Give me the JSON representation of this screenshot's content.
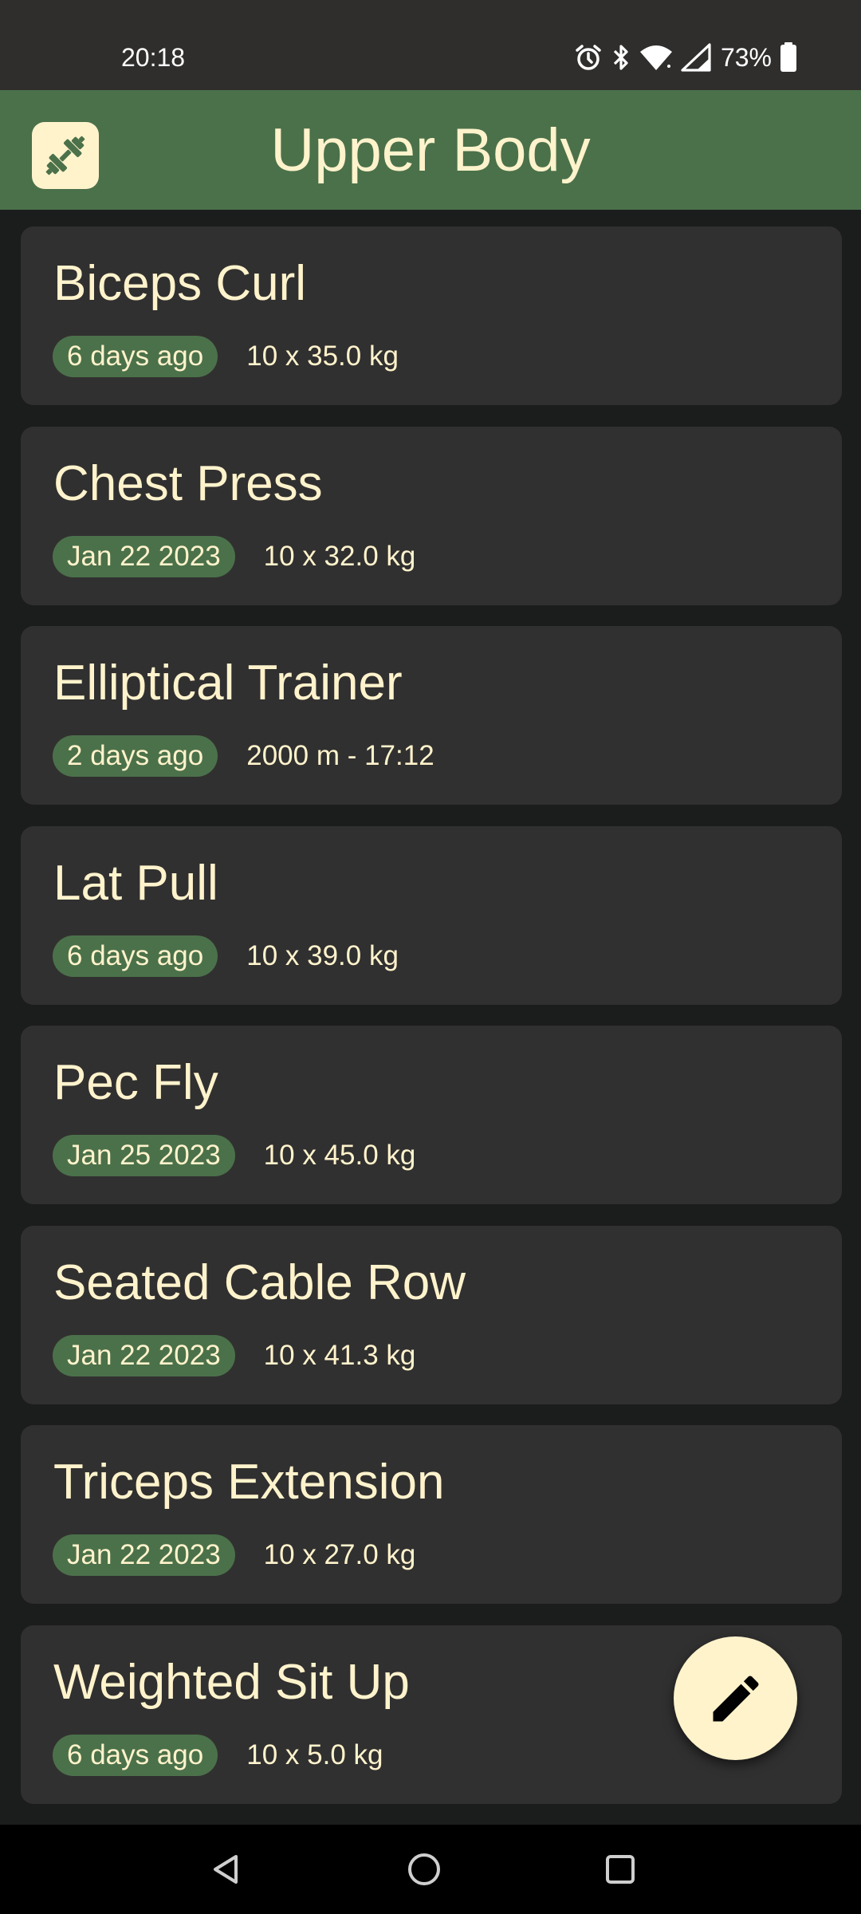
{
  "status_bar": {
    "time": "20:18",
    "battery": "73%",
    "icons": [
      "alarm-icon",
      "bluetooth-icon",
      "wifi-icon",
      "cellular-signal-icon",
      "battery-icon"
    ]
  },
  "app_bar": {
    "title": "Upper Body",
    "logo_icon": "dumbbell-icon"
  },
  "exercises": [
    {
      "name": "Biceps Curl",
      "last_done": "6 days ago",
      "detail": "10 x 35.0 kg"
    },
    {
      "name": "Chest Press",
      "last_done": "Jan 22 2023",
      "detail": "10 x 32.0 kg"
    },
    {
      "name": "Elliptical Trainer",
      "last_done": "2 days ago",
      "detail": "2000 m - 17:12"
    },
    {
      "name": "Lat Pull",
      "last_done": "6 days ago",
      "detail": "10 x 39.0 kg"
    },
    {
      "name": "Pec Fly",
      "last_done": "Jan 25 2023",
      "detail": "10 x 45.0 kg"
    },
    {
      "name": "Seated Cable Row",
      "last_done": "Jan 22 2023",
      "detail": "10 x 41.3 kg"
    },
    {
      "name": "Triceps Extension",
      "last_done": "Jan 22 2023",
      "detail": "10 x 27.0 kg"
    },
    {
      "name": "Weighted Sit Up",
      "last_done": "6 days ago",
      "detail": "10 x 5.0 kg"
    }
  ],
  "fab": {
    "icon": "pencil-icon"
  },
  "nav_bar": {
    "icons": [
      "back-icon",
      "home-icon",
      "recents-icon"
    ]
  },
  "colors": {
    "accent_green": "#4b714a",
    "cream": "#fff3cc",
    "card": "#313030",
    "background": "#1b1c1c"
  }
}
